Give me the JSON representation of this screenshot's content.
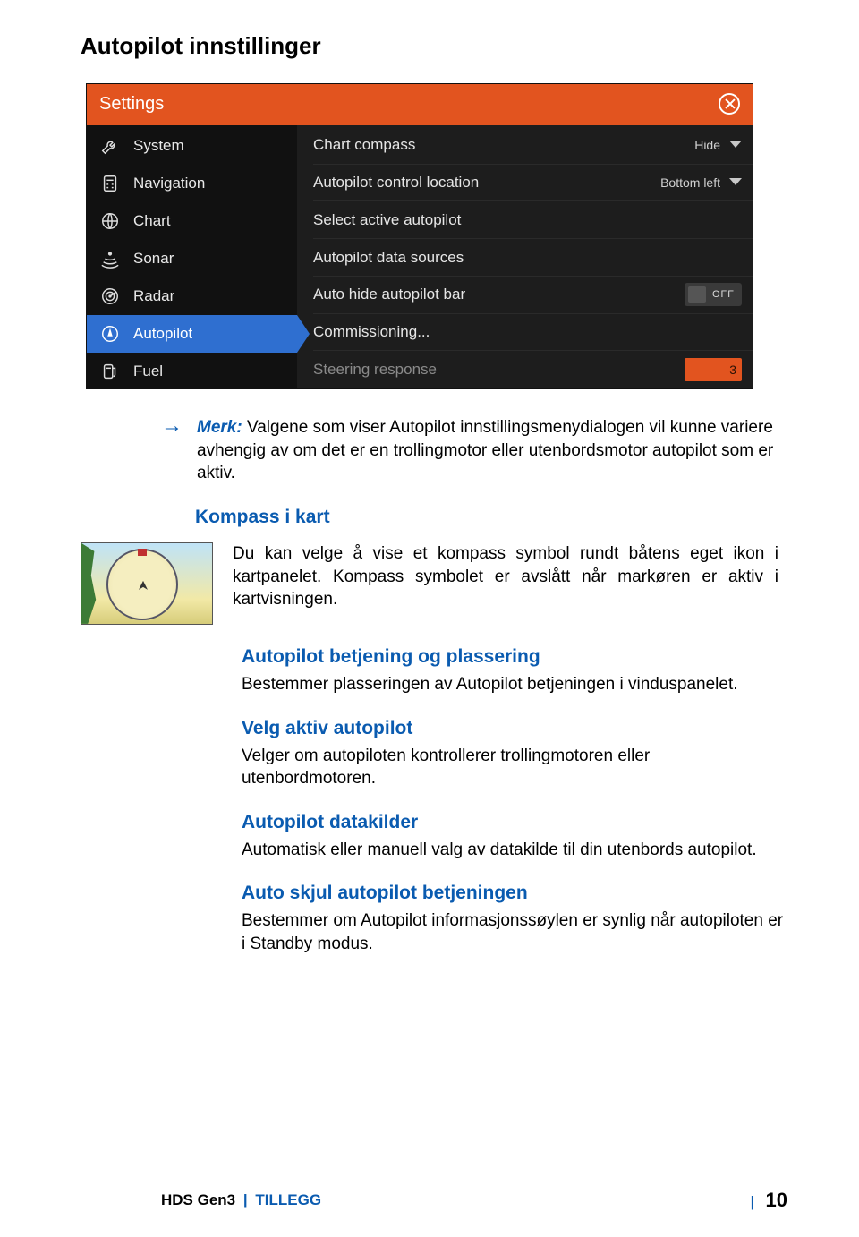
{
  "page_title": "Autopilot innstillinger",
  "settings_panel": {
    "title": "Settings",
    "sidebar": [
      {
        "label": "System"
      },
      {
        "label": "Navigation"
      },
      {
        "label": "Chart"
      },
      {
        "label": "Sonar"
      },
      {
        "label": "Radar"
      },
      {
        "label": "Autopilot",
        "active": true
      },
      {
        "label": "Fuel"
      }
    ],
    "options": {
      "chart_compass": {
        "label": "Chart compass",
        "value": "Hide"
      },
      "control_location": {
        "label": "Autopilot control location",
        "value": "Bottom left"
      },
      "select_active": {
        "label": "Select active autopilot"
      },
      "data_sources": {
        "label": "Autopilot data sources"
      },
      "auto_hide": {
        "label": "Auto hide autopilot bar",
        "toggle": "OFF"
      },
      "commissioning": {
        "label": "Commissioning..."
      },
      "steering_response": {
        "label": "Steering response",
        "value": "3"
      }
    }
  },
  "note": {
    "label": "Merk:",
    "text": "Valgene som viser Autopilot innstillingsmenydialogen vil kunne variere avhengig av om det er en trollingmotor eller utenbordsmotor autopilot som er aktiv."
  },
  "kompass": {
    "head": "Kompass i kart",
    "text": "Du kan velge å vise et kompass symbol rundt båtens eget ikon i kartpanelet. Kompass symbolet er avslått når markøren er aktiv i kartvisningen."
  },
  "s1": {
    "head": "Autopilot betjening og plassering",
    "text": "Bestemmer plasseringen av Autopilot betjeningen i vinduspanelet."
  },
  "s2": {
    "head": "Velg aktiv autopilot",
    "text": "Velger om autopiloten kontrollerer trollingmotoren eller utenbordmotoren."
  },
  "s3": {
    "head": "Autopilot datakilder",
    "text": "Automatisk eller manuell valg av datakilde til din utenbords autopilot."
  },
  "s4": {
    "head": "Auto skjul autopilot betjeningen",
    "text": "Bestemmer om Autopilot informasjonssøylen er synlig når autopiloten er i Standby modus."
  },
  "footer": {
    "product": "HDS Gen3",
    "addendum": "TILLEGG",
    "page": "10"
  }
}
